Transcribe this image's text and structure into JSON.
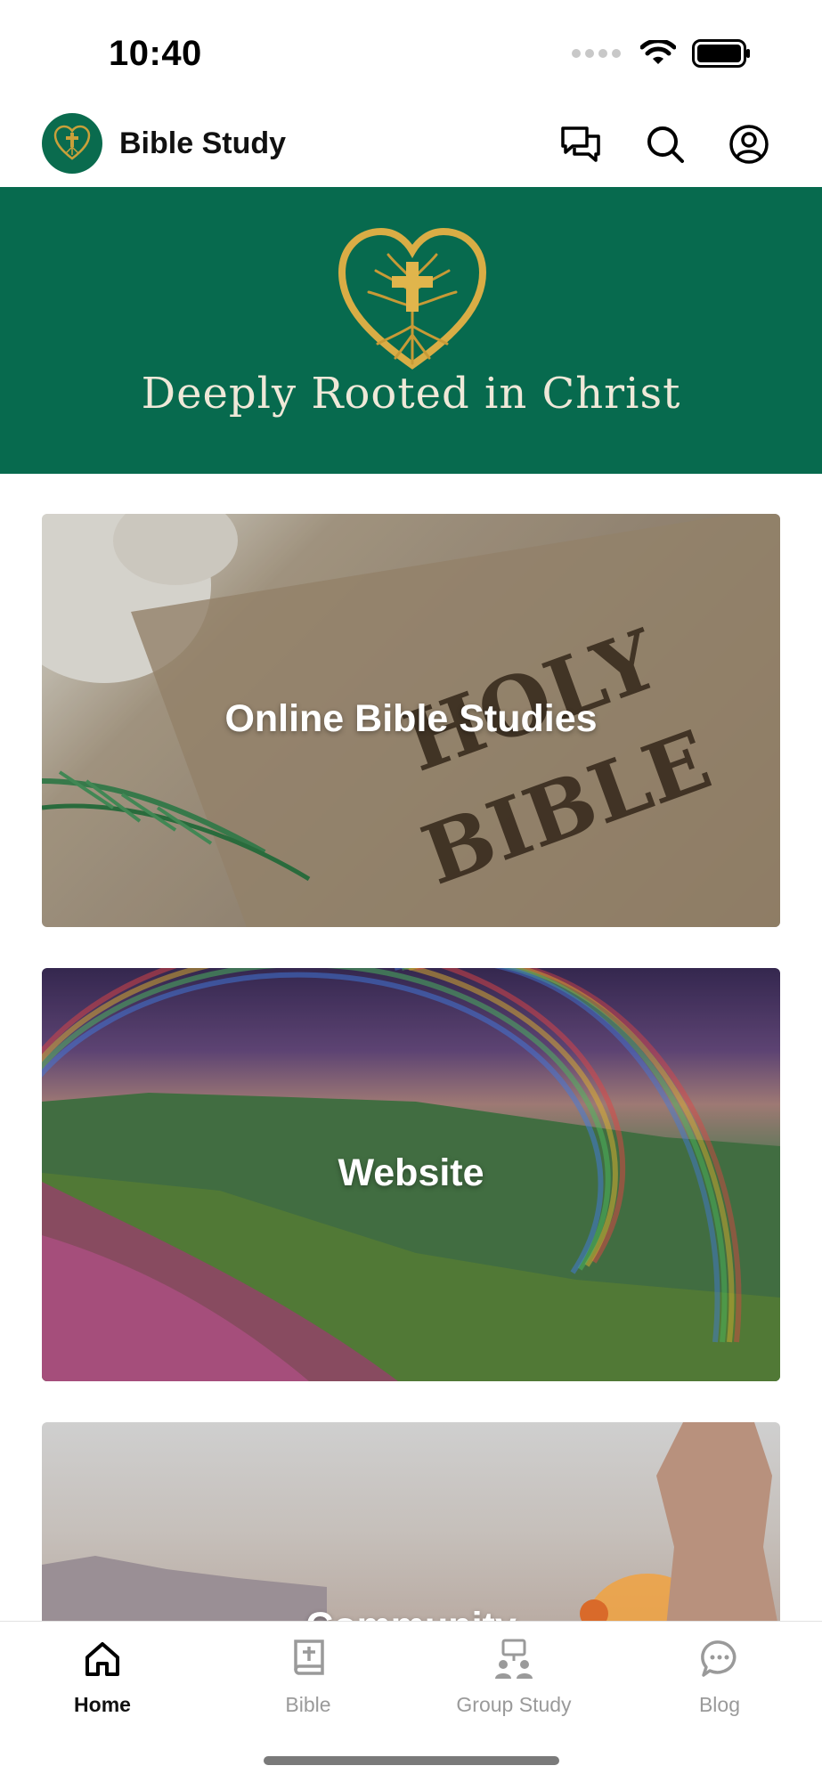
{
  "status": {
    "time": "10:40"
  },
  "header": {
    "title": "Bible Study"
  },
  "banner": {
    "text": "Deeply Rooted in Christ"
  },
  "cards": [
    {
      "label": "Online Bible Studies"
    },
    {
      "label": "Website"
    },
    {
      "label": "Community"
    }
  ],
  "nav": [
    {
      "label": "Home",
      "icon": "home-icon",
      "active": true
    },
    {
      "label": "Bible",
      "icon": "bible-icon",
      "active": false
    },
    {
      "label": "Group Study",
      "icon": "group-study-icon",
      "active": false
    },
    {
      "label": "Blog",
      "icon": "chat-bubble-icon",
      "active": false
    }
  ],
  "colors": {
    "brand": "#076a4e",
    "gold": "#c9a03a"
  }
}
